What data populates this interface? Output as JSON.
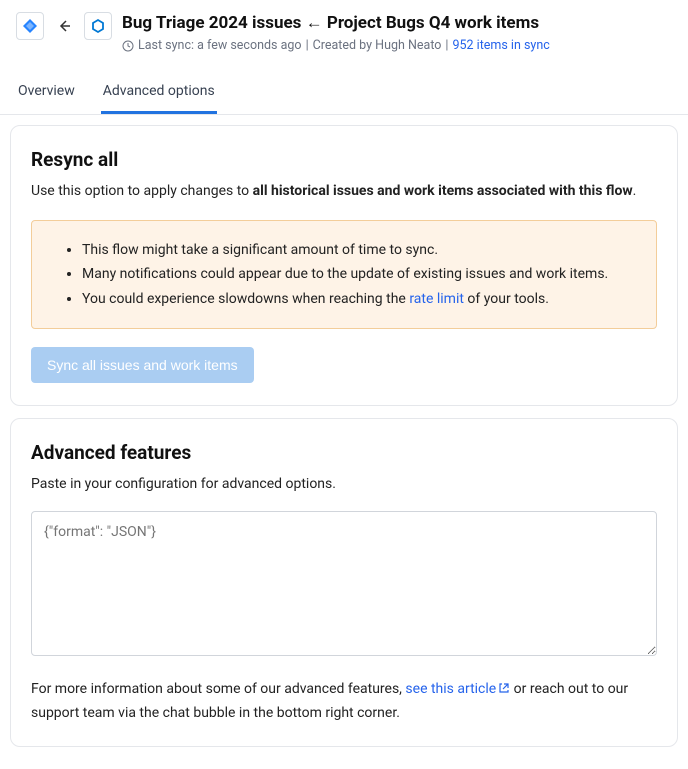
{
  "header": {
    "title": "Bug Triage 2024 issues ← Project Bugs Q4 work items",
    "last_sync_prefix": "Last sync: ",
    "last_sync_time": "a few seconds ago",
    "created_by_prefix": "Created by ",
    "created_by": "Hugh Neato",
    "items_link": "952 items in sync",
    "separator": " | "
  },
  "icons": {
    "left_app": "jira-icon",
    "right_app": "devops-icon",
    "back": "back-arrow-icon",
    "clock": "clock-icon",
    "external": "external-link-icon"
  },
  "tabs": [
    {
      "label": "Overview",
      "active": false
    },
    {
      "label": "Advanced options",
      "active": true
    }
  ],
  "resync": {
    "title": "Resync all",
    "desc_prefix": "Use this option to apply changes to ",
    "desc_strong": "all historical issues and work items associated with this flow",
    "desc_suffix": ".",
    "warnings": [
      "This flow might take a significant amount of time to sync.",
      "Many notifications could appear due to the update of existing issues and work items."
    ],
    "warning3_prefix": "You could experience slowdowns when reaching the ",
    "warning3_link": "rate limit",
    "warning3_suffix": " of your tools.",
    "button_label": "Sync all issues and work items"
  },
  "advanced": {
    "title": "Advanced features",
    "desc": "Paste in your configuration for advanced options.",
    "placeholder": "{\"format\": \"JSON\"}",
    "footer_prefix": "For more information about some of our advanced features,  ",
    "footer_link": "see this article",
    "footer_suffix": "  or reach out to our support team via the chat bubble in the bottom right corner."
  }
}
